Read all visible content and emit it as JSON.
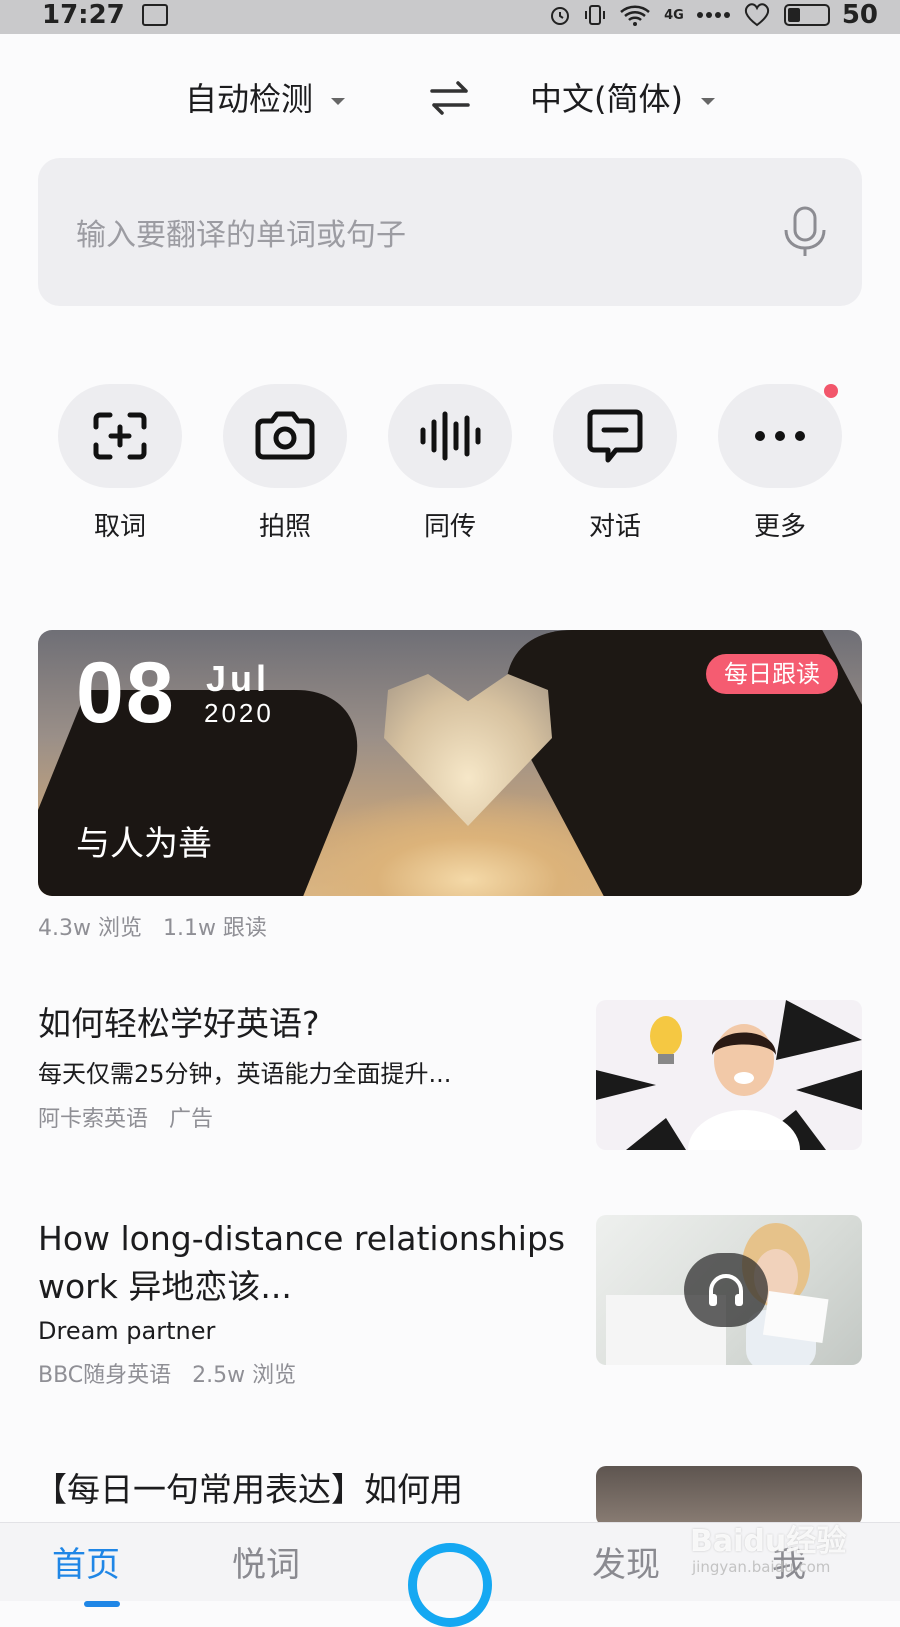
{
  "status_bar": {
    "time": "17:27",
    "network": "4G",
    "battery_level": "50"
  },
  "lang_bar": {
    "source_lang": "自动检测",
    "target_lang": "中文(简体)"
  },
  "input": {
    "placeholder": "输入要翻译的单词或句子"
  },
  "tools": [
    {
      "label": "取词",
      "icon": "scan-word-icon"
    },
    {
      "label": "拍照",
      "icon": "camera-icon"
    },
    {
      "label": "同传",
      "icon": "sound-wave-icon"
    },
    {
      "label": "对话",
      "icon": "chat-icon"
    },
    {
      "label": "更多",
      "icon": "more-icon"
    }
  ],
  "banner": {
    "day": "08",
    "month": "Jul",
    "year": "2020",
    "badge": "每日跟读",
    "title": "与人为善",
    "stats": "4.3w 浏览   1.1w 跟读"
  },
  "articles": [
    {
      "title": "如何轻松学好英语?",
      "subtitle": "每天仅需25分钟，英语能力全面提升...",
      "meta": "阿卡索英语   广告"
    },
    {
      "title": "How long-distance relationships work 异地恋该...",
      "subtitle": "Dream partner",
      "meta": "BBC随身英语   2.5w 浏览"
    },
    {
      "title": "【每日一句常用表达】如何用",
      "subtitle": "",
      "meta": ""
    }
  ],
  "tabbar": {
    "tabs": [
      "首页",
      "悦词",
      "发现",
      "我"
    ],
    "active": "首页"
  },
  "watermark": {
    "text": "Baidu经验",
    "url_text": "jingyan.baidu.com"
  },
  "colors": {
    "accent": "#1f86e6",
    "badge": "#f55c71",
    "ring": "#15a8f2"
  }
}
